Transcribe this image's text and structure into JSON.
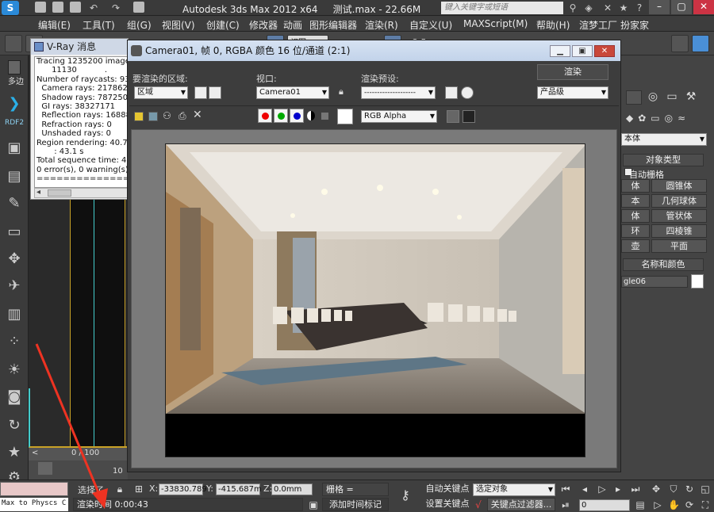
{
  "app": {
    "title": "Autodesk 3ds Max  2012 x64",
    "file": "测试.max - 22.66M",
    "search_placeholder": "键入关键字或短语"
  },
  "menu": [
    "编辑(E)",
    "工具(T)",
    "组(G)",
    "视图(V)",
    "创建(C)",
    "修改器",
    "动画",
    "图形编辑器",
    "渲染(R)",
    "自定义(U)",
    "MAXScript(M)",
    "帮助(H)",
    "渲梦工厂",
    "扮家家"
  ],
  "toolbar": {
    "view_label": "视图",
    "snap_value": "2.5"
  },
  "left_labels": {
    "edit_poly": "多边",
    "rdf": "RDF2"
  },
  "viewport": {
    "timeline": "0 / 100",
    "tick": "10"
  },
  "vray": {
    "title": "V-Ray 消息",
    "lines": [
      "Tracing 1235200 image sa",
      "      11130           .",
      "Number of raycasts: 93286",
      "  Camera rays: 2178624",
      "  Shadow rays: 78725029",
      "  GI rays: 38327171",
      "  Reflection rays: 1688891",
      "  Refraction rays: 0",
      "  Unshaded rays: 0",
      "Region rendering: 40.7 s",
      "       : 43.1 s",
      "Total sequence time: 43.3",
      "0 error(s), 0 warning(s)",
      "=========================="
    ]
  },
  "frame": {
    "title": "Camera01, 帧 0, RGBA 颜色 16 位/通道 (2:1)",
    "area_label": "要渲染的区域:",
    "area_value": "区域",
    "viewport_label": "视口:",
    "viewport_value": "Camera01",
    "preset_label": "渲染预设:",
    "preset_value": "--------------------",
    "render_button": "渲染",
    "quality_value": "产品级",
    "channel_value": "RGB Alpha"
  },
  "right_panel": {
    "object_type_header": "对象类型",
    "autogrid": "自动栅格",
    "primitives": [
      [
        "体",
        "圆锥体"
      ],
      [
        "本",
        "几何球体"
      ],
      [
        "体",
        "管状体"
      ],
      [
        "环",
        "四棱锥"
      ],
      [
        "壶",
        "平面"
      ]
    ],
    "name_color_header": "名称和颜色",
    "name_value": "gle06",
    "category_value": "本体"
  },
  "bottom": {
    "selection": "选择了",
    "x_label": "X:",
    "x_value": "-33830.789",
    "y_label": "Y:",
    "y_value": "-415.687m",
    "z_label": "Z:",
    "z_value": "0.0mm",
    "grid": "栅格 = 10.0mm",
    "auto_key": "自动关键点",
    "set_key": "设置关键点",
    "selected_object": "选定对象",
    "key_filter": "关键点过滤器...",
    "frame_value": "0",
    "render_time": "渲染时间  0:00:43",
    "add_time_tag": "添加时间标记",
    "script_listener": "Max to Physcs C"
  }
}
